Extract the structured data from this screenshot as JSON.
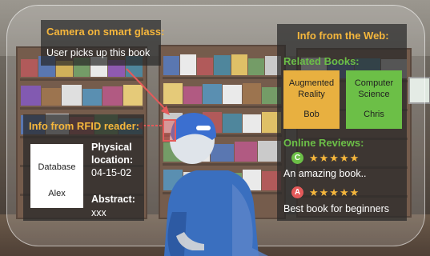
{
  "camera": {
    "title": "Camera on smart glass:",
    "text": "User picks up this book"
  },
  "rfid": {
    "title": "Info from RFID reader:",
    "db_label": "Database",
    "db_name": "Alex",
    "location_label_1": "Physical",
    "location_label_2": "location:",
    "location_value": "04-15-02",
    "abstract_label": "Abstract:",
    "abstract_value": "xxx"
  },
  "web": {
    "title": "Info from the Web:",
    "related_title": "Related Books:",
    "books": [
      {
        "title_1": "Augmented",
        "title_2": "Reality",
        "author": "Bob",
        "color": "#e8b040"
      },
      {
        "title_1": "Computer",
        "title_2": "Science",
        "author": "Chris",
        "color": "#6cbf47"
      }
    ],
    "reviews_title": "Online Reviews:",
    "reviews": [
      {
        "initial": "C",
        "stars": "★★★★★",
        "rating": 5,
        "text": "An amazing book..",
        "color": "#6cbf47"
      },
      {
        "initial": "A",
        "stars": "★★★★★",
        "rating": 5,
        "text": "Best book for beginners",
        "color": "#e45a5a"
      }
    ]
  },
  "colors": {
    "accent": "#f6b73c",
    "highlight": "#e45a5a",
    "panel": "#282828"
  }
}
